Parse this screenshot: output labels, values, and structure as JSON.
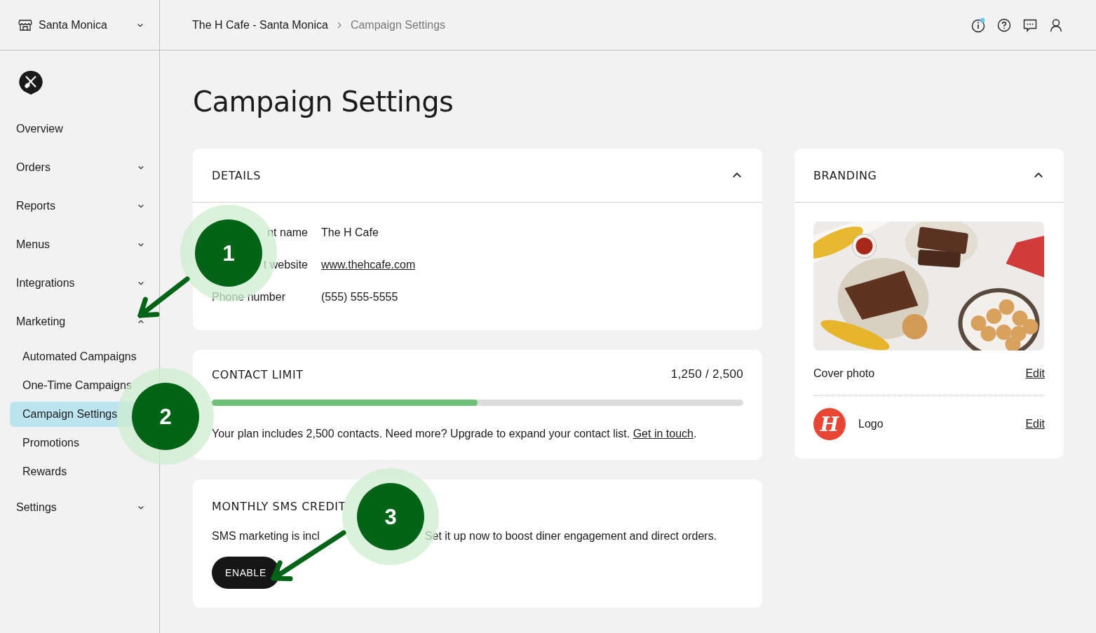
{
  "location_selector": {
    "label": "Santa Monica"
  },
  "breadcrumb": [
    {
      "label": "The H Cafe - Santa Monica",
      "current": false
    },
    {
      "label": "Campaign Settings",
      "current": true
    }
  ],
  "header_icons": [
    {
      "kind": "info",
      "badge": true
    },
    {
      "kind": "help",
      "badge": false
    },
    {
      "kind": "chat",
      "badge": false
    },
    {
      "kind": "user",
      "badge": false
    }
  ],
  "sidebar": {
    "items": [
      {
        "label": "Overview",
        "kind": "link"
      },
      {
        "label": "Orders",
        "kind": "group",
        "expanded": false
      },
      {
        "label": "Reports",
        "kind": "group",
        "expanded": false
      },
      {
        "label": "Menus",
        "kind": "group",
        "expanded": false
      },
      {
        "label": "Integrations",
        "kind": "group",
        "expanded": false
      },
      {
        "label": "Marketing",
        "kind": "group",
        "expanded": true,
        "children": [
          {
            "label": "Automated Campaigns",
            "selected": false
          },
          {
            "label": "One-Time Campaigns",
            "selected": false
          },
          {
            "label": "Campaign Settings",
            "selected": true
          },
          {
            "label": "Promotions",
            "selected": false
          },
          {
            "label": "Rewards",
            "selected": false
          }
        ]
      },
      {
        "label": "Settings",
        "kind": "group",
        "expanded": false
      }
    ]
  },
  "page_title": "Campaign Settings",
  "details": {
    "title": "DETAILS",
    "expanded": true,
    "fields": [
      {
        "label": "nt name",
        "value": "The H Cafe",
        "kind": "text"
      },
      {
        "label": "t website",
        "value": "www.thehcafe.com",
        "kind": "link"
      },
      {
        "label": "Phone number",
        "value": "(555) 555-5555",
        "kind": "text"
      }
    ]
  },
  "contact_limit": {
    "title": "CONTACT LIMIT",
    "count": "1,250 / 2,500",
    "level": 0.5,
    "note": "Your plan includes 2,500 contacts. Need more? Upgrade to expand your contact list.",
    "link": "Get in touch",
    "note_end": "."
  },
  "sms_credit": {
    "title": "MONTHLY SMS CREDIT",
    "text_start": "SMS marketing is incl",
    "text_end": "Set it up now to boost diner engagement and direct orders.",
    "button": "ENABLE"
  },
  "branding": {
    "title": "BRANDING",
    "expanded": true,
    "cover": {
      "kind": "picture",
      "label": "Cover photo",
      "action": "Edit"
    },
    "logo": {
      "mark": "H",
      "label": "Logo",
      "action": "Edit"
    }
  },
  "callouts": [
    {
      "number": "1",
      "arrow": true
    },
    {
      "number": "2",
      "arrow": false
    },
    {
      "number": "3",
      "arrow": true
    }
  ]
}
